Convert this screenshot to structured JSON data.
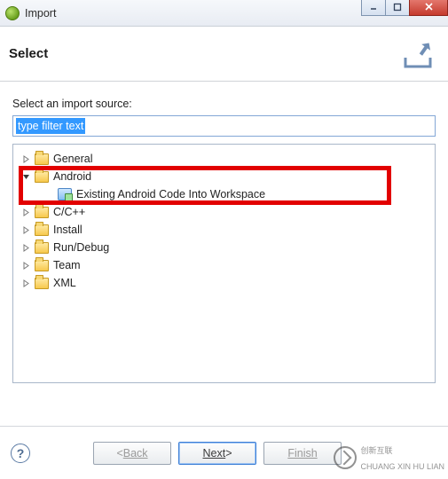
{
  "window": {
    "title": "Import"
  },
  "header": {
    "heading": "Select"
  },
  "main": {
    "prompt": "Select an import source:",
    "filter_selected_text": "type filter text",
    "tree": {
      "general": "General",
      "android": "Android",
      "android_existing": "Existing Android Code Into Workspace",
      "cpp": "C/C++",
      "install": "Install",
      "rundebug": "Run/Debug",
      "team": "Team",
      "xml": "XML"
    }
  },
  "footer": {
    "back": "Back",
    "next": "Next",
    "finish": "Finish",
    "help": "?"
  },
  "watermark": {
    "line1": "创新互联",
    "line2": "CHUANG XIN HU LIAN"
  }
}
